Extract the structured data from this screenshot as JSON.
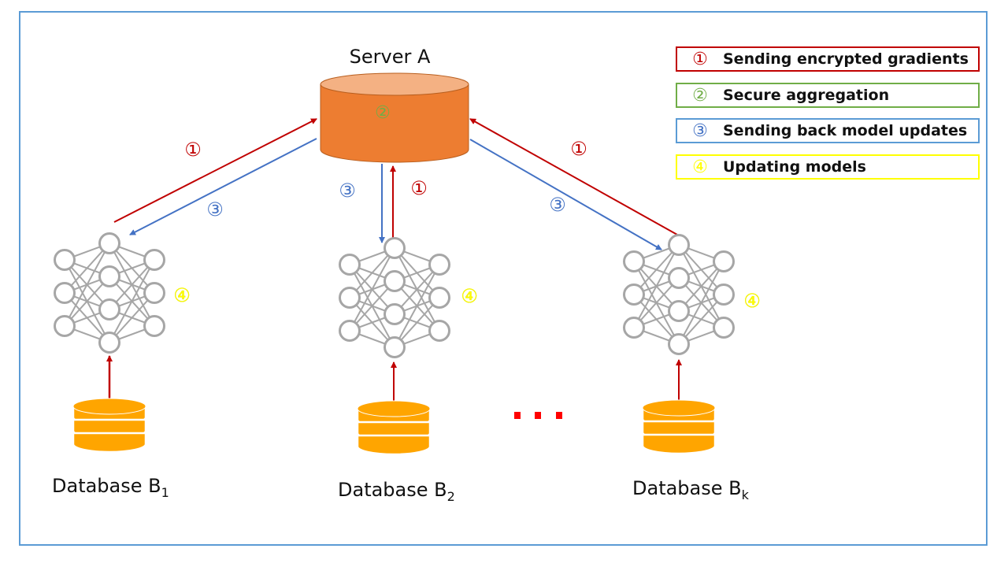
{
  "server": {
    "title": "Server A",
    "step_label": "②"
  },
  "legend": [
    {
      "num": "①",
      "text": "Sending encrypted gradients",
      "color": "#c00000"
    },
    {
      "num": "②",
      "text": "Secure aggregation",
      "color": "#70ad47"
    },
    {
      "num": "③",
      "text": "Sending back model updates",
      "color": "#4472c4"
    },
    {
      "num": "④",
      "text": "Updating models",
      "color": "#ffff00"
    }
  ],
  "clients": [
    {
      "db_label": "Database B",
      "db_sub": "1",
      "step_up": "①",
      "step_down": "③",
      "step_update": "④"
    },
    {
      "db_label": "Database B",
      "db_sub": "2",
      "step_up": "①",
      "step_down": "③",
      "step_update": "④"
    },
    {
      "db_label": "Database B",
      "db_sub": "k",
      "step_up": "①",
      "step_down": "③",
      "step_update": "④"
    }
  ],
  "ellipsis": "...",
  "colors": {
    "server_body": "#ed7d31",
    "server_top": "#f4b183",
    "database": "#ffa500",
    "nn": "#a6a6a6",
    "frame": "#5b9bd5"
  }
}
